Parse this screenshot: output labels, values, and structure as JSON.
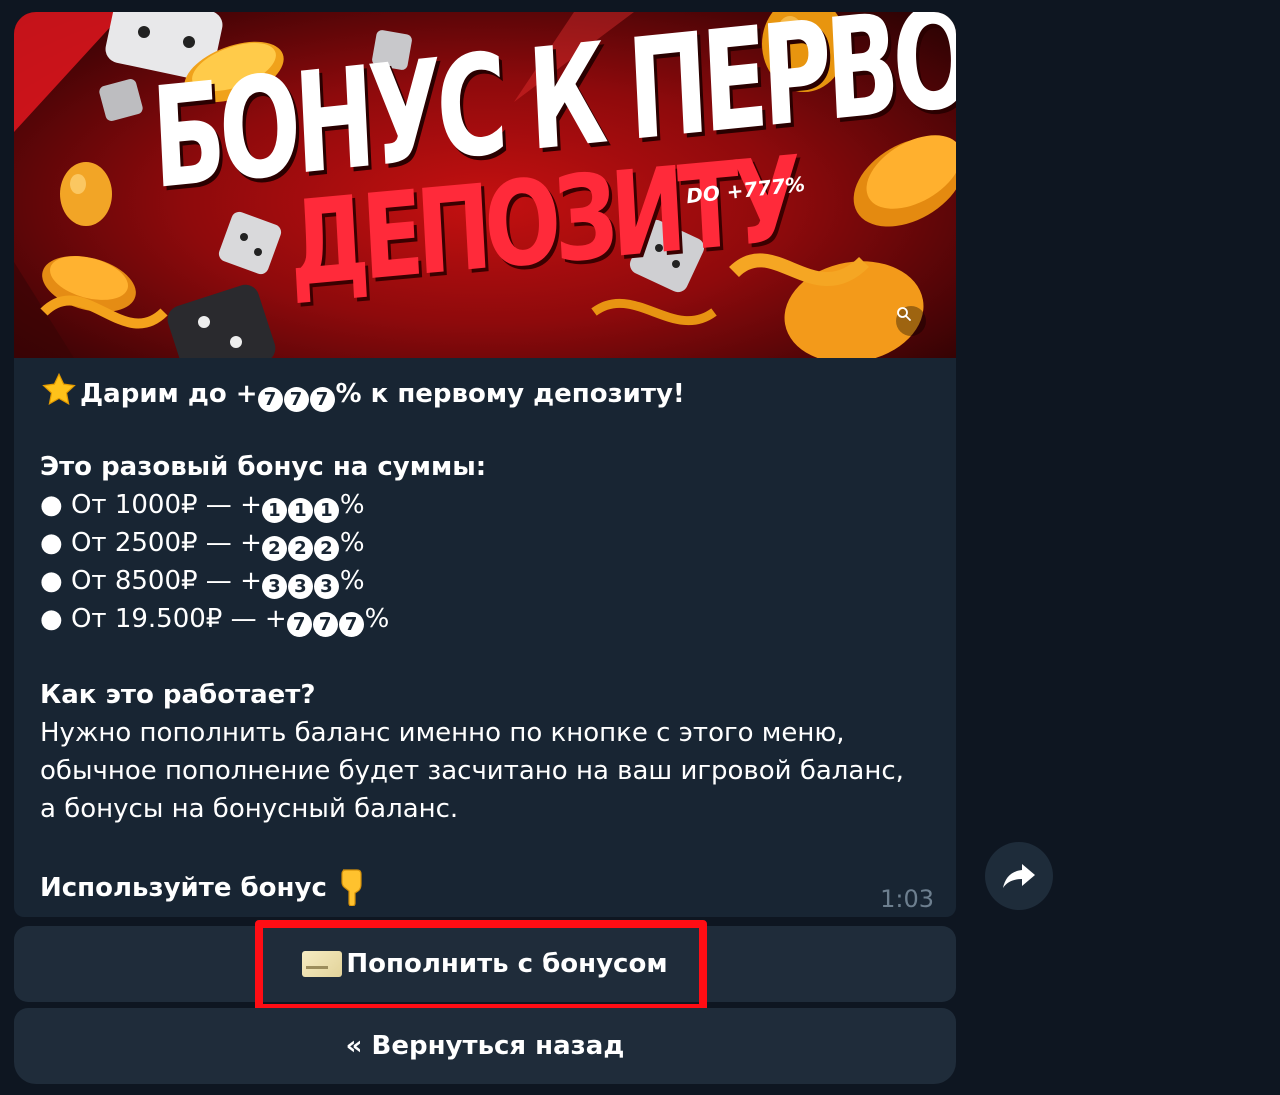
{
  "message": {
    "banner": {
      "title_line1": "БОНУС К ПЕРВОМУ",
      "title_line2": "ДЕПОЗИТУ",
      "subtitle": "DO +777%"
    },
    "lines": {
      "headline_text": "Дарим до +",
      "headline_digits": [
        "7",
        "7",
        "7"
      ],
      "headline_rest": "% к первому депозиту!",
      "tiers_title": "Это разовый бонус на суммы:",
      "tiers": [
        {
          "prefix": "● От 1000₽ — +",
          "digits": [
            "1",
            "1",
            "1"
          ],
          "suffix": "%"
        },
        {
          "prefix": "● От 2500₽ — +",
          "digits": [
            "2",
            "2",
            "2"
          ],
          "suffix": "%"
        },
        {
          "prefix": "● От 8500₽ — +",
          "digits": [
            "3",
            "3",
            "3"
          ],
          "suffix": "%"
        },
        {
          "prefix": "● От 19.500₽ — +",
          "digits": [
            "7",
            "7",
            "7"
          ],
          "suffix": "%"
        }
      ],
      "how_title": "Как это работает?",
      "how_lines": [
        "Нужно пополнить баланс именно по кнопке с этого меню,",
        "обычное пополнение будет засчитано на ваш игровой баланс,",
        "а бонусы на бонусный баланс."
      ],
      "cta": "Используйте бонус"
    },
    "time": "1:03"
  },
  "keyboard": {
    "topup_label": "Пополнить с бонусом",
    "back_label": "« Вернуться назад"
  },
  "colors": {
    "background": "#0e1621",
    "bubble": "#182533",
    "button": "#1f2c3a",
    "highlight": "#ff0d14"
  },
  "icons": {
    "star": "star-emoji-icon",
    "hand": "pointing-down-hand-icon",
    "card": "credit-card-icon",
    "share": "share-arrow-icon",
    "zoom": "magnifier-icon"
  }
}
